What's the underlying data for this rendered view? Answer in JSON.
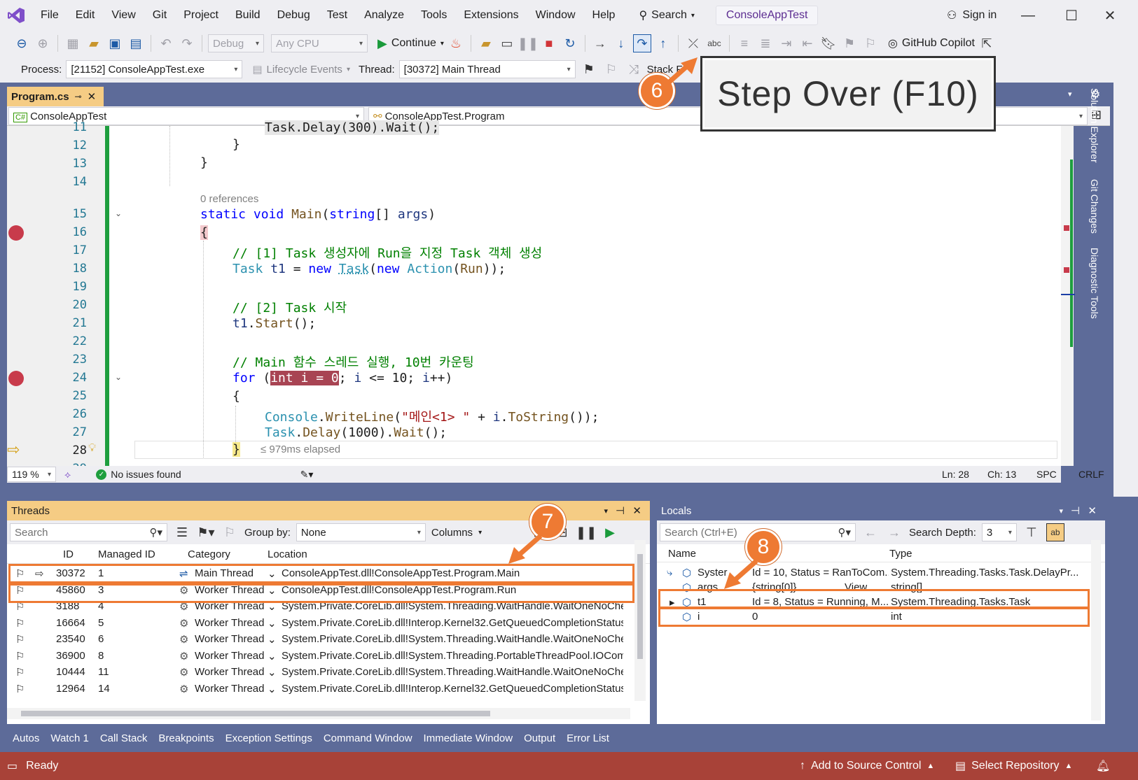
{
  "menu": [
    "File",
    "Edit",
    "View",
    "Git",
    "Project",
    "Build",
    "Debug",
    "Test",
    "Analyze",
    "Tools",
    "Extensions",
    "Window",
    "Help"
  ],
  "title_search": "Search",
  "app_title": "ConsoleAppTest",
  "sign_in": "Sign in",
  "toolbar1": {
    "config": "Debug",
    "platform": "Any CPU",
    "continue": "Continue",
    "copilot": "GitHub Copilot"
  },
  "toolbar2": {
    "process_label": "Process:",
    "process_value": "[21152] ConsoleAppTest.exe",
    "lifecycle": "Lifecycle Events",
    "thread_label": "Thread:",
    "thread_value": "[30372] Main Thread",
    "stack_frame": "Stack F"
  },
  "callout": {
    "text": "Step Over (F10)",
    "badge": "6"
  },
  "doc_tab": "Program.cs",
  "nav": {
    "left": "ConsoleAppTest",
    "right": "ConsoleAppTest.Program"
  },
  "code_lines": [
    {
      "n": "11",
      "text": "Task.Delay(300).Wait();"
    },
    {
      "n": "12",
      "text": "}"
    },
    {
      "n": "13",
      "text": "}"
    },
    {
      "n": "14",
      "text": ""
    },
    {
      "n": "15",
      "text": "static void Main(string[] args)"
    },
    {
      "n": "16",
      "text": "{"
    },
    {
      "n": "17",
      "text": "// [1] Task 생성자에 Run을 지정 Task 객체 생성"
    },
    {
      "n": "18",
      "text": "Task t1 = new Task(new Action(Run));"
    },
    {
      "n": "19",
      "text": ""
    },
    {
      "n": "20",
      "text": "// [2] Task 시작"
    },
    {
      "n": "21",
      "text": "t1.Start();"
    },
    {
      "n": "22",
      "text": ""
    },
    {
      "n": "23",
      "text": "// Main 함수 스레드 실행, 10번 카운팅"
    },
    {
      "n": "24",
      "text": "for (int i = 0; i <= 10; i++)"
    },
    {
      "n": "25",
      "text": "{"
    },
    {
      "n": "26",
      "text": "Console.WriteLine(\"메인<1> \" + i.ToString());"
    },
    {
      "n": "27",
      "text": "Task.Delay(1000).Wait();"
    },
    {
      "n": "28",
      "text": "}"
    },
    {
      "n": "29",
      "text": ""
    }
  ],
  "references": "0 references",
  "elapsed": "≤ 979ms elapsed",
  "editor_status": {
    "zoom": "119 %",
    "issues": "No issues found",
    "ln": "Ln: 28",
    "ch": "Ch: 13",
    "spc": "SPC",
    "crlf": "CRLF"
  },
  "side_tabs": [
    "Solution Explorer",
    "Git Changes",
    "Diagnostic Tools"
  ],
  "threads": {
    "title": "Threads",
    "search": "Search",
    "group_by_label": "Group by:",
    "group_by_value": "None",
    "columns": "Columns",
    "badge": "7",
    "headers": [
      "ID",
      "Managed ID",
      "Category",
      "Location"
    ],
    "rows": [
      {
        "id": "30372",
        "mid": "1",
        "cat": "Main Thread",
        "loc": "ConsoleAppTest.dll!ConsoleAppTest.Program.Main",
        "current": true
      },
      {
        "id": "45860",
        "mid": "3",
        "cat": "Worker Thread",
        "loc": "ConsoleAppTest.dll!ConsoleAppTest.Program.Run",
        "current": false
      },
      {
        "id": "3188",
        "mid": "4",
        "cat": "Worker Thread",
        "loc": "System.Private.CoreLib.dll!System.Threading.WaitHandle.WaitOneNoChe",
        "current": false
      },
      {
        "id": "16664",
        "mid": "5",
        "cat": "Worker Thread",
        "loc": "System.Private.CoreLib.dll!Interop.Kernel32.GetQueuedCompletionStatus",
        "current": false
      },
      {
        "id": "23540",
        "mid": "6",
        "cat": "Worker Thread",
        "loc": "System.Private.CoreLib.dll!System.Threading.WaitHandle.WaitOneNoChe",
        "current": false
      },
      {
        "id": "36900",
        "mid": "8",
        "cat": "Worker Thread",
        "loc": "System.Private.CoreLib.dll!System.Threading.PortableThreadPool.IOComp",
        "current": false
      },
      {
        "id": "10444",
        "mid": "11",
        "cat": "Worker Thread",
        "loc": "System.Private.CoreLib.dll!System.Threading.WaitHandle.WaitOneNoChe",
        "current": false
      },
      {
        "id": "12964",
        "mid": "14",
        "cat": "Worker Thread",
        "loc": "System.Private.CoreLib.dll!Interop.Kernel32.GetQueuedCompletionStatus",
        "current": false
      }
    ]
  },
  "locals": {
    "title": "Locals",
    "search": "Search (Ctrl+E)",
    "depth_label": "Search Depth:",
    "depth_value": "3",
    "badge": "8",
    "headers": [
      "Name",
      "Value",
      "Type"
    ],
    "rows": [
      {
        "name": "Syster",
        "value": "Id = 10, Status = RanToCom...",
        "type": "System.Threading.Tasks.Task.DelayPr..."
      },
      {
        "name": "args",
        "value": "{string[0]}",
        "type": "string[]"
      },
      {
        "name": "t1",
        "value": "Id = 8, Status = Running, M...",
        "type": "System.Threading.Tasks.Task"
      },
      {
        "name": "i",
        "value": "0",
        "type": "int"
      }
    ],
    "view_label": "View"
  },
  "bottom_tabs": [
    "Autos",
    "Watch 1",
    "Call Stack",
    "Breakpoints",
    "Exception Settings",
    "Command Window",
    "Immediate Window",
    "Output",
    "Error List"
  ],
  "statusbar": {
    "ready": "Ready",
    "source_control": "Add to Source Control",
    "repository": "Select Repository"
  }
}
